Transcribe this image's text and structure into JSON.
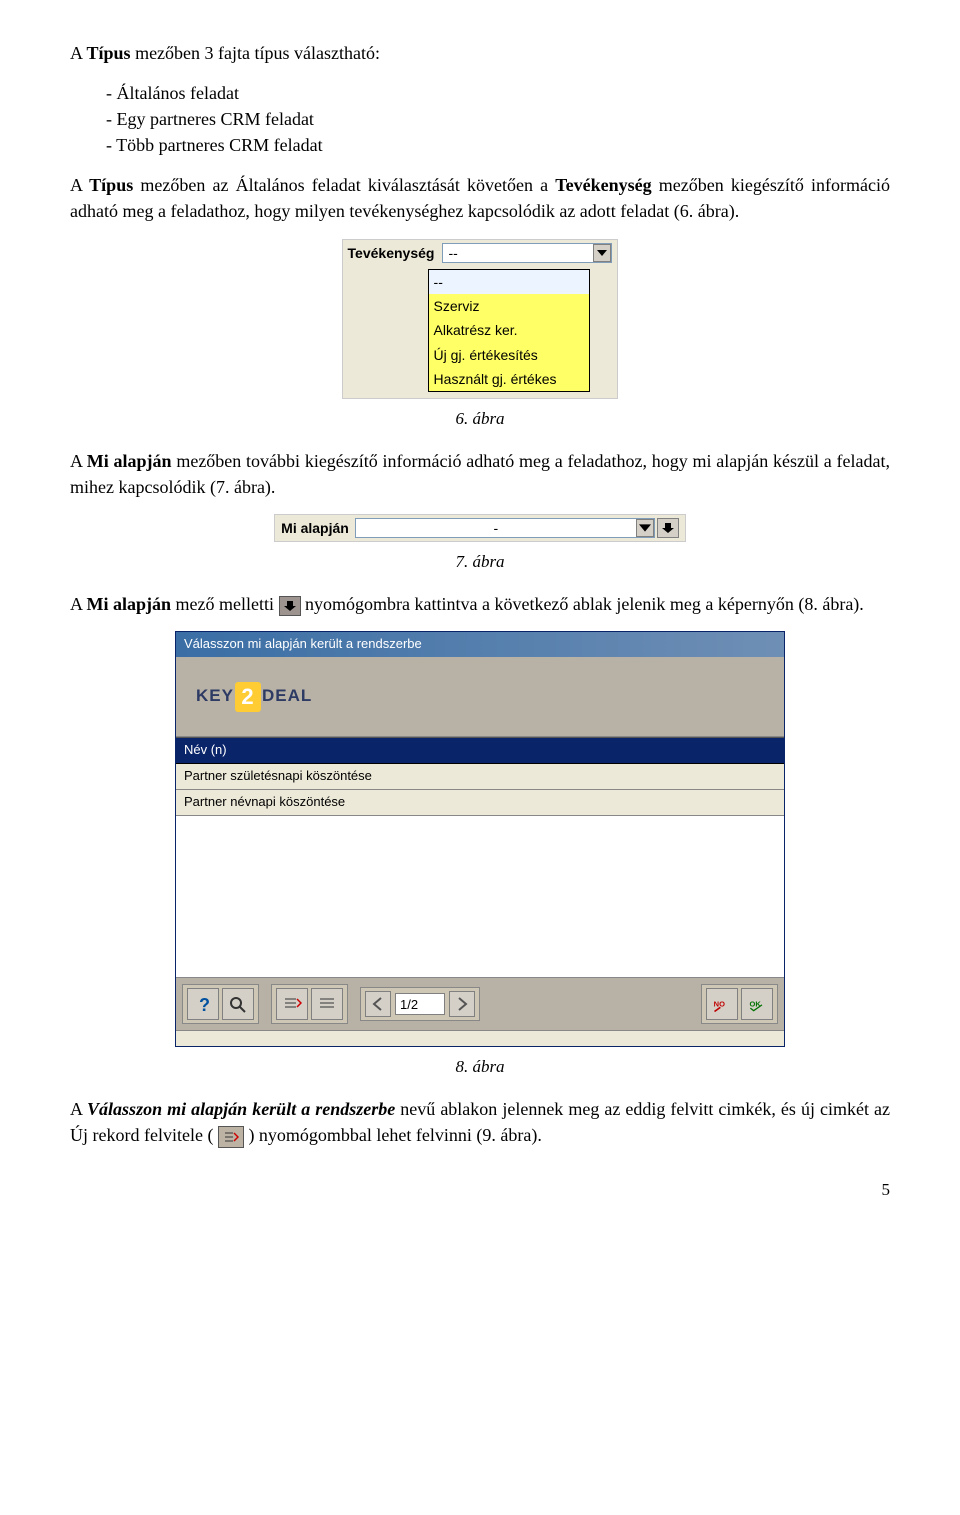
{
  "intro": {
    "p1_pre": "A ",
    "p1_bold": "Típus",
    "p1_post": " mezőben 3 fajta típus választható:",
    "bullets": [
      "Általános feladat",
      "Egy partneres CRM feladat",
      "Több partneres CRM feladat"
    ],
    "p2_pre": "A ",
    "p2_b1": "Típus",
    "p2_mid1": " mezőben az Általános feladat kiválasztását követően a ",
    "p2_b2": "Tevékenység",
    "p2_mid2": " mezőben kiegészítő információ adható meg a feladathoz, hogy milyen tevékenységhez kapcsolódik az adott feladat (6. ábra)."
  },
  "fig6": {
    "label": "Tevékenység",
    "selected": "--",
    "items": [
      "--",
      "Szerviz",
      "Alkatrész ker.",
      "Új gj. értékesítés",
      "Használt gj. értékes"
    ],
    "caption": "6. ábra"
  },
  "para_mi": {
    "pre": "A ",
    "b": "Mi alapján",
    "post": " mezőben további kiegészítő információ adható meg a feladathoz, hogy mi alapján készül a feladat, mihez kapcsolódik (7. ábra)."
  },
  "fig7": {
    "label": "Mi alapján",
    "value": "-",
    "caption": "7. ábra"
  },
  "para_mi2": {
    "pre": "A ",
    "b": "Mi alapján",
    "mid": " mező melletti ",
    "post": " nyomógombra kattintva a következő ablak jelenik meg a képernyőn (8. ábra)."
  },
  "fig8": {
    "title": "Válasszon mi alapján került a rendszerbe",
    "logo_left": "KEY",
    "logo_num": "2",
    "logo_right": "DEAL",
    "header": "Név (n)",
    "rows": [
      "Partner születésnapi köszöntése",
      "Partner névnapi köszöntése"
    ],
    "pager": "1/2",
    "no": "NO",
    "ok": "OK",
    "caption": "8. ábra"
  },
  "para_end": {
    "pre": "A ",
    "b": "Válasszon mi alapján került a rendszerbe",
    "mid": " nevű ablakon jelennek meg az eddig felvitt cimkék, és új cimkét az Új rekord felvitele (",
    "post": ") nyomógombbal lehet felvinni (9. ábra)."
  },
  "pagenum": "5"
}
